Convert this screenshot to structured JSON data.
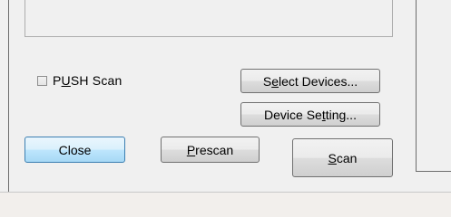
{
  "push_scan": {
    "label_before": "P",
    "label_underlined": "U",
    "label_after": "SH Scan",
    "checked": false
  },
  "buttons": {
    "select_devices": {
      "before": "S",
      "underlined": "e",
      "after": "lect Devices..."
    },
    "device_setting": {
      "before": "Device Se",
      "underlined": "t",
      "after": "ting..."
    },
    "close": {
      "label": "Close"
    },
    "prescan": {
      "before": "",
      "underlined": "P",
      "after": "rescan"
    },
    "scan": {
      "before": "",
      "underlined": "S",
      "after": "can"
    }
  }
}
